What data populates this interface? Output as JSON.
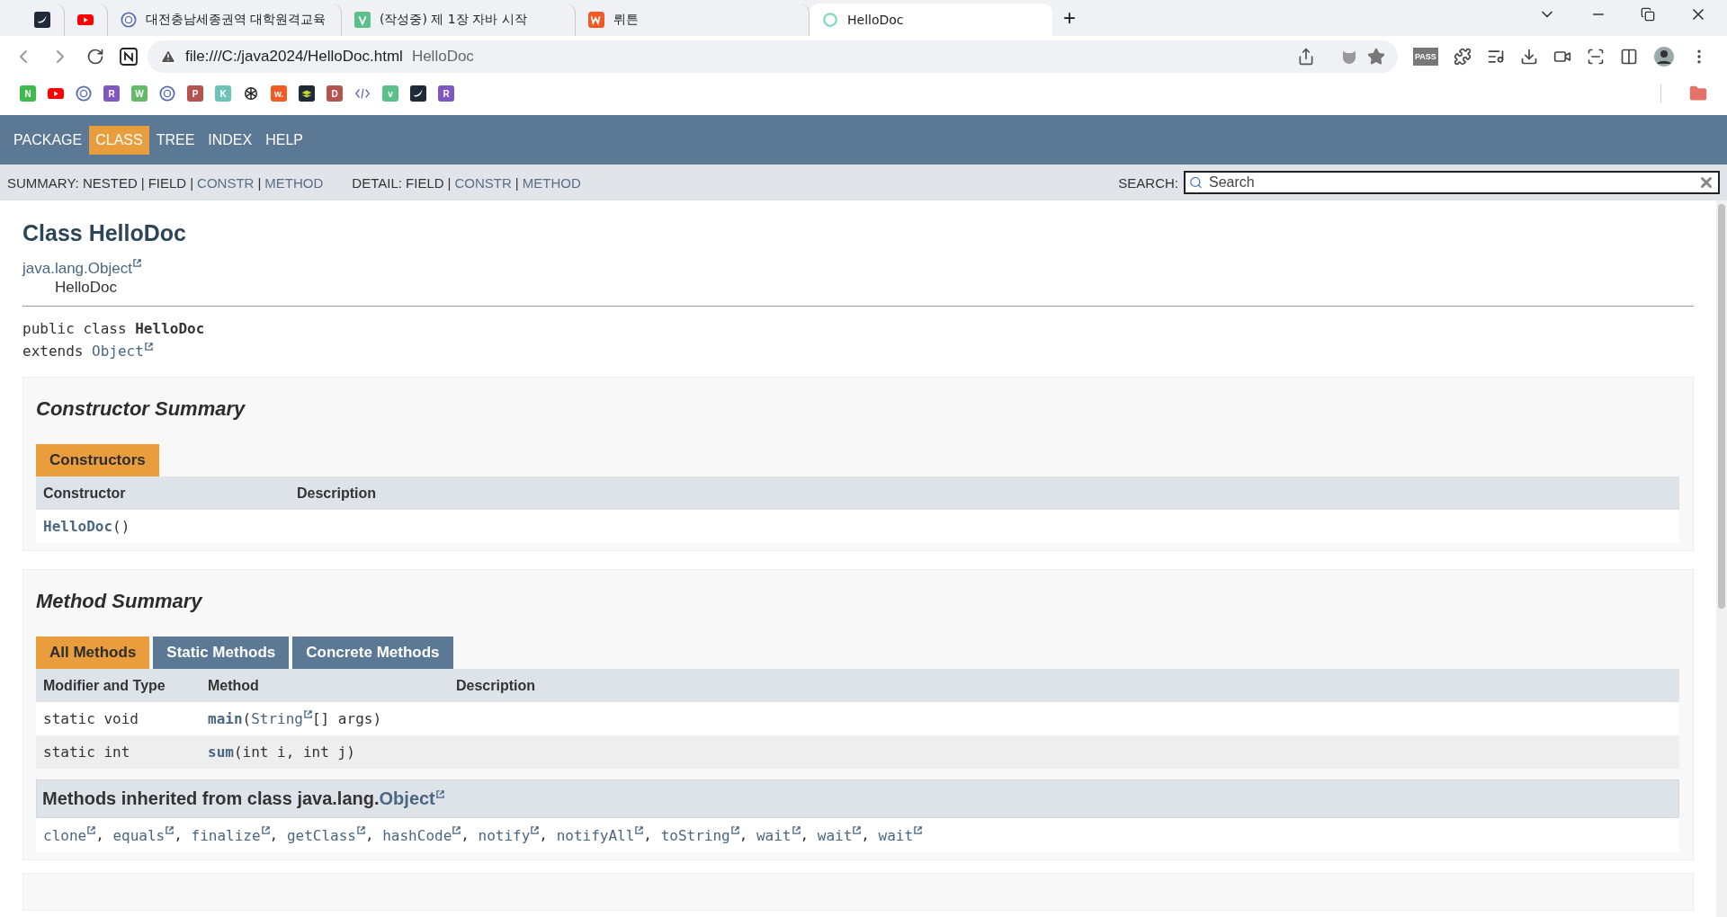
{
  "browser": {
    "tabs": [
      {
        "kind": "bird",
        "selected": false
      },
      {
        "kind": "youtube",
        "selected": false
      },
      {
        "kind": "seal",
        "title": "대전충남세종권역 대학원격교육",
        "selected": false
      },
      {
        "kind": "v",
        "title": "(작성중) 제 1장 자바 시작",
        "selected": false
      },
      {
        "kind": "wrtn",
        "title": "뤼튼",
        "selected": false
      },
      {
        "kind": "ring",
        "title": "HelloDoc",
        "selected": true
      }
    ],
    "new_tab": "+",
    "address": {
      "url": "file:///C:/java2024/HelloDoc.html",
      "page_title": "HelloDoc"
    },
    "extension_label": "PASS",
    "bookmarks": [
      {
        "kind": "letter",
        "letter": "N",
        "color": "#3fb950"
      },
      {
        "kind": "youtube"
      },
      {
        "kind": "seal"
      },
      {
        "kind": "letter",
        "letter": "R",
        "color": "#7e57c2"
      },
      {
        "kind": "letter",
        "letter": "W",
        "color": "#66bb6a"
      },
      {
        "kind": "seal"
      },
      {
        "kind": "letter",
        "letter": "P",
        "color": "#b5544f"
      },
      {
        "kind": "letter",
        "letter": "K",
        "color": "#6fc2b9"
      },
      {
        "kind": "openai"
      },
      {
        "kind": "letter",
        "letter": "w.",
        "color": "#f25a24"
      },
      {
        "kind": "layers"
      },
      {
        "kind": "letter",
        "letter": "D",
        "color": "#b5544f"
      },
      {
        "kind": "code"
      },
      {
        "kind": "letter",
        "letter": "v",
        "color": "#5cc08a"
      },
      {
        "kind": "bird"
      },
      {
        "kind": "letter",
        "letter": "R",
        "color": "#7e57c2"
      }
    ]
  },
  "doc": {
    "nav": [
      {
        "label": "PACKAGE",
        "selected": false
      },
      {
        "label": "CLASS",
        "selected": true
      },
      {
        "label": "TREE",
        "selected": false
      },
      {
        "label": "INDEX",
        "selected": false
      },
      {
        "label": "HELP",
        "selected": false
      }
    ],
    "subnav": [
      {
        "label": "SUMMARY:",
        "separator": "|",
        "items": [
          {
            "label": "NESTED",
            "link": false
          },
          {
            "label": "FIELD",
            "link": false
          },
          {
            "label": "CONSTR",
            "link": true
          },
          {
            "label": "METHOD",
            "link": true
          }
        ]
      },
      {
        "label": "DETAIL:",
        "separator": "|",
        "items": [
          {
            "label": "FIELD",
            "link": false
          },
          {
            "label": "CONSTR",
            "link": true
          },
          {
            "label": "METHOD",
            "link": true
          }
        ]
      }
    ],
    "search": {
      "label": "SEARCH:",
      "placeholder": "Search"
    },
    "title": "Class HelloDoc",
    "inheritance": [
      {
        "label": "java.lang.Object",
        "link": true
      },
      {
        "label": "HelloDoc",
        "link": false
      }
    ],
    "signature": {
      "prefix": "public class ",
      "name": "HelloDoc",
      "extends": "extends ",
      "super": "Object"
    },
    "constructor_summary": {
      "heading": "Constructor Summary",
      "tabs": [
        {
          "label": "Constructors",
          "selected": true
        }
      ],
      "columns": [
        "Constructor",
        "Description"
      ],
      "rows": [
        {
          "cells": [
            [
              {
                "kind": "name",
                "text": "HelloDoc"
              },
              {
                "kind": "plain",
                "text": "()"
              }
            ]
          ]
        }
      ]
    },
    "method_summary": {
      "heading": "Method Summary",
      "tabs": [
        {
          "label": "All Methods",
          "selected": true
        },
        {
          "label": "Static Methods",
          "selected": false
        },
        {
          "label": "Concrete Methods",
          "selected": false
        }
      ],
      "columns": [
        "Modifier and Type",
        "Method",
        "Description"
      ],
      "rows": [
        {
          "modifier": "static void",
          "method": [
            {
              "kind": "name",
              "text": "main"
            },
            {
              "kind": "plain",
              "text": "("
            },
            {
              "kind": "ext",
              "text": "String"
            },
            {
              "kind": "plain",
              "text": "[] args)"
            }
          ]
        },
        {
          "modifier": "static int",
          "method": [
            {
              "kind": "name",
              "text": "sum"
            },
            {
              "kind": "plain",
              "text": "(int i, int j)"
            }
          ]
        }
      ],
      "inherited": {
        "prefix": "Methods inherited from class java.lang.",
        "link": "Object",
        "separator": ",",
        "methods": [
          "clone",
          "equals",
          "finalize",
          "getClass",
          "hashCode",
          "notify",
          "notifyAll",
          "toString",
          "wait",
          "wait",
          "wait"
        ]
      }
    }
  }
}
